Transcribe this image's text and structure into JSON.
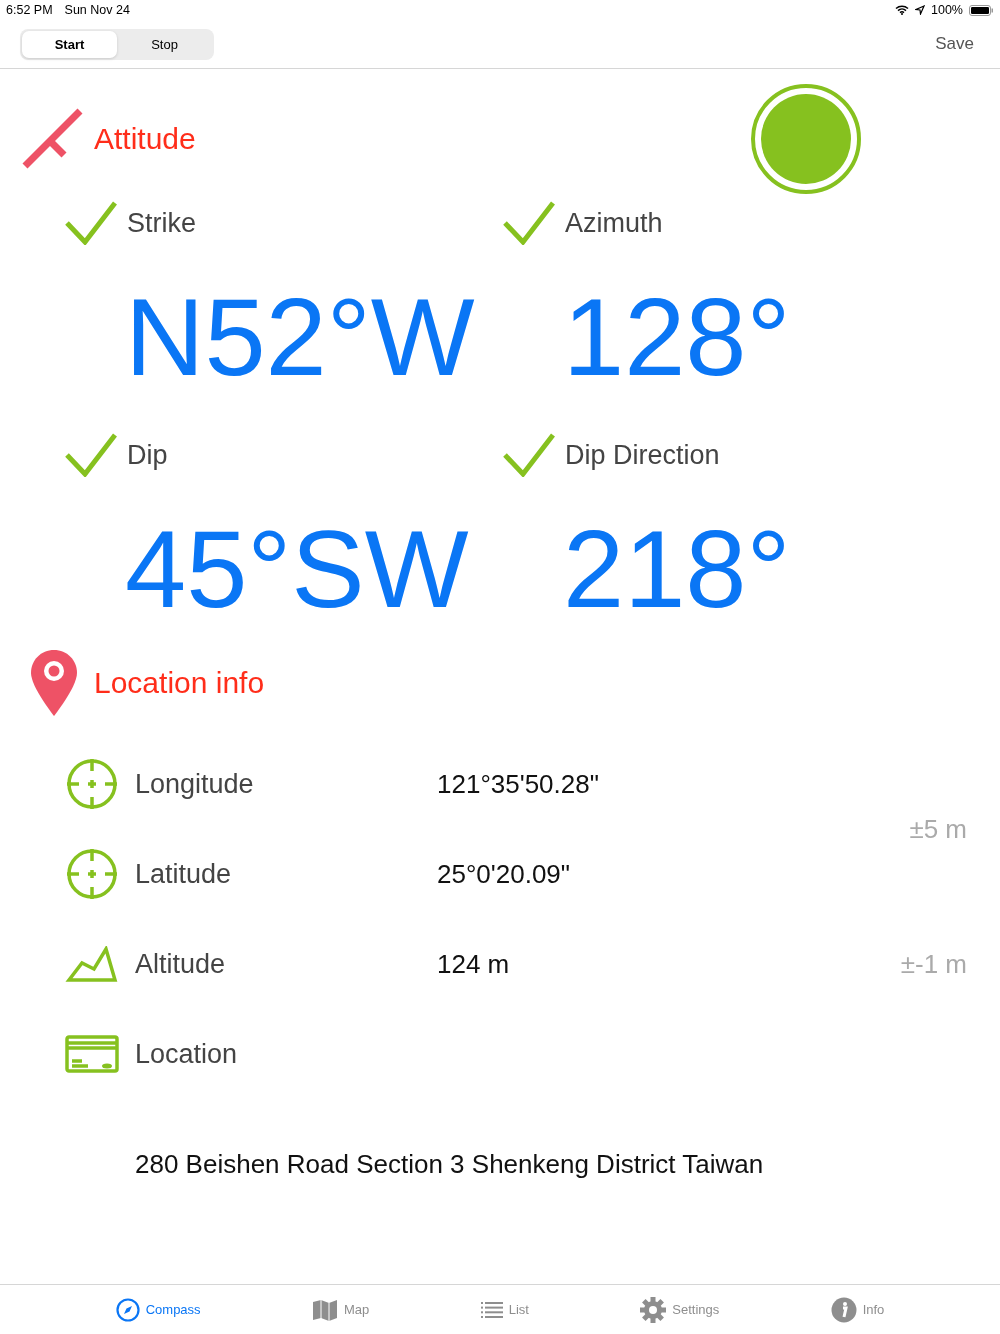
{
  "status_bar": {
    "time": "6:52 PM",
    "date": "Sun Nov 24",
    "battery": "100%"
  },
  "nav_bar": {
    "segments": [
      {
        "label": "Start",
        "selected": true
      },
      {
        "label": "Stop",
        "selected": false
      }
    ],
    "save": "Save"
  },
  "attitude": {
    "title": "Attitude",
    "measurements": [
      {
        "label": "Strike",
        "checked": true,
        "value": "N52°W"
      },
      {
        "label": "Azimuth",
        "checked": true,
        "value": "128°"
      },
      {
        "label": "Dip",
        "checked": true,
        "value": "45°SW"
      },
      {
        "label": "Dip Direction",
        "checked": true,
        "value": "218°"
      }
    ]
  },
  "location": {
    "title": "Location info",
    "horizontal_accuracy": "±5 m",
    "rows": [
      {
        "kind": "crosshair",
        "label": "Longitude",
        "value": "121°35'50.28\""
      },
      {
        "kind": "crosshair",
        "label": "Latitude",
        "value": "25°0'20.09\""
      },
      {
        "kind": "mountain",
        "label": "Altitude",
        "value": "124 m",
        "accuracy": "±-1 m"
      },
      {
        "kind": "card",
        "label": "Location"
      }
    ],
    "address": "280 Beishen Road Section 3 Shenkeng District Taiwan"
  },
  "tab_bar": [
    {
      "kind": "compass",
      "label": "Compass",
      "selected": true
    },
    {
      "kind": "map",
      "label": "Map",
      "selected": false
    },
    {
      "kind": "list",
      "label": "List",
      "selected": false
    },
    {
      "kind": "settings",
      "label": "Settings",
      "selected": false
    },
    {
      "kind": "info",
      "label": "Info",
      "selected": false
    }
  ]
}
